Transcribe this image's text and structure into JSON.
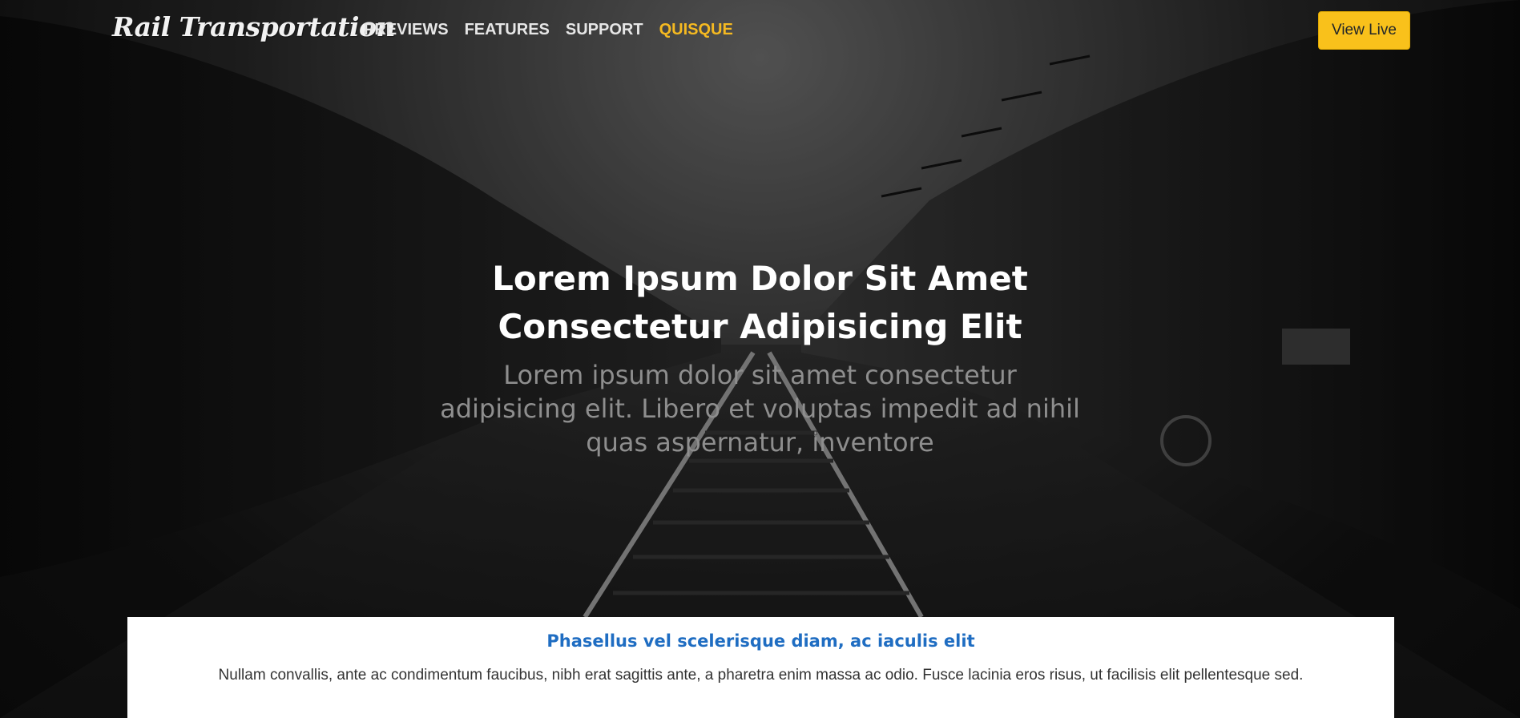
{
  "navbar": {
    "brand": "Rail Transportation",
    "links": [
      {
        "label": "PREVIEWS"
      },
      {
        "label": "FEATURES"
      },
      {
        "label": "SUPPORT"
      },
      {
        "label": "QUISQUE"
      }
    ],
    "cta_label": "View Live"
  },
  "hero": {
    "title_line1": "Lorem Ipsum Dolor Sit Amet",
    "title_line2": "Consectetur Adipisicing Elit",
    "subtitle": "Lorem ipsum dolor sit amet consectetur adipisicing elit. Libero et voluptas impedit ad nihil quas aspernatur, inventore"
  },
  "info": {
    "heading": "Phasellus vel scelerisque diam, ac iaculis elit",
    "text": "Nullam convallis, ante ac condimentum faucibus, nibh erat sagittis ante, a pharetra enim massa ac odio. Fusce lacinia eros risus, ut facilisis elit pellentesque sed."
  },
  "colors": {
    "accent": "#f5b921",
    "button": "#f9c11b",
    "heading_blue": "#1f6dc2"
  }
}
